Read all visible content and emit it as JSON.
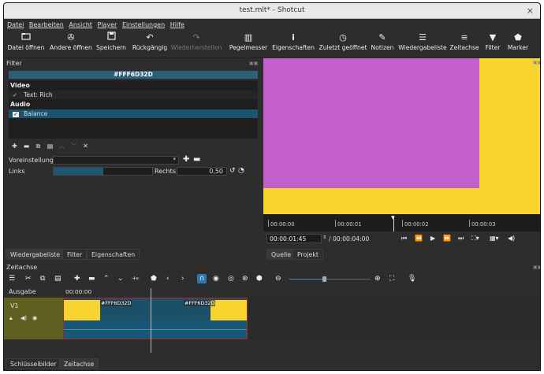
{
  "window": {
    "title": "test.mlt* - Shotcut",
    "close_icon": "×"
  },
  "menu": [
    {
      "label": "Datei"
    },
    {
      "label": "Bearbeiten"
    },
    {
      "label": "Ansicht"
    },
    {
      "label": "Player"
    },
    {
      "label": "Einstellungen"
    },
    {
      "label": "Hilfe"
    }
  ],
  "toolbar": [
    {
      "icon": "folder-open-icon",
      "glyph": "▭",
      "label": "Datei öffnen"
    },
    {
      "icon": "open-other-icon",
      "glyph": "⚙",
      "label": "Andere öffnen"
    },
    {
      "icon": "save-icon",
      "glyph": "💾",
      "label": "Speichern"
    },
    {
      "icon": "undo-icon",
      "glyph": "↶",
      "label": "Rückgängig"
    },
    {
      "icon": "redo-icon",
      "glyph": "↷",
      "label": "Wiederherstellen",
      "disabled": true
    },
    {
      "icon": "meter-icon",
      "glyph": "▥",
      "label": "Pegelmesser"
    },
    {
      "icon": "info-icon",
      "glyph": "ℹ",
      "label": "Eigenschaften"
    },
    {
      "icon": "clock-icon",
      "glyph": "◷",
      "label": "Zuletzt geöffnet"
    },
    {
      "icon": "notes-icon",
      "glyph": "✎",
      "label": "Notizen"
    },
    {
      "icon": "playlist-icon",
      "glyph": "☰",
      "label": "Wiedergabeliste"
    },
    {
      "icon": "timeline-icon",
      "glyph": "≡",
      "label": "Zeitachse"
    },
    {
      "icon": "filter-icon",
      "glyph": "▼",
      "label": "Filter"
    },
    {
      "icon": "marker-icon",
      "glyph": "⬟",
      "label": "Marker"
    }
  ],
  "filter_panel": {
    "title": "Filter",
    "clip_color": "#FFF6D32D",
    "groups": [
      {
        "heading": "Video",
        "items": [
          {
            "check": "✓",
            "label": "Text: Rich",
            "selected": false
          }
        ]
      },
      {
        "heading": "Audio",
        "items": [
          {
            "check": "✓",
            "label": "Balance",
            "selected": true
          }
        ]
      }
    ],
    "preset_label": "Voreinstellung",
    "preset_value": "",
    "balance": {
      "left_label": "Links",
      "right_label": "Rechts",
      "value": "0,50",
      "fill_fraction": 0.5
    }
  },
  "left_tabs": [
    "Wiedergabeliste",
    "Filter",
    "Eigenschaften"
  ],
  "viewer": {
    "colors": {
      "background": "#f8d42e",
      "foreground": "#c25fcd"
    },
    "ruler_labels": [
      "00:00:00",
      "00:00:01",
      "00:00:02",
      "00:00:03"
    ],
    "current_time": "00:00:01:45",
    "total_time": "/ 00:00:04:00"
  },
  "right_tabs": [
    "Quelle",
    "Projekt"
  ],
  "timeline": {
    "title": "Zeitachse",
    "output_label": "Ausgabe",
    "ruler_start": "00:00:00",
    "track_name": "V1",
    "clip_labels": [
      "#FFF6D32D",
      "#FFF6D32D"
    ]
  },
  "bottom_tabs": [
    "Schlüsselbilder",
    "Zeitachse"
  ]
}
